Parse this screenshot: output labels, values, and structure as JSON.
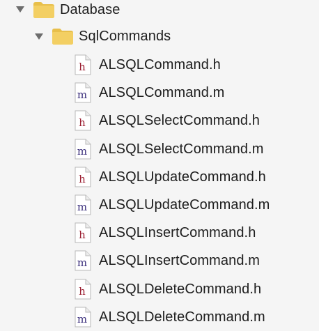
{
  "tree": {
    "database": {
      "label": "Database",
      "expanded_icon": "disclosure-triangle-down",
      "icon": "folder-icon"
    },
    "sqlcommands": {
      "label": "SqlCommands",
      "expanded_icon": "disclosure-triangle-down",
      "icon": "folder-icon"
    },
    "files": [
      {
        "name": "ALSQLCommand.h",
        "type_letter": "h"
      },
      {
        "name": "ALSQLCommand.m",
        "type_letter": "m"
      },
      {
        "name": "ALSQLSelectCommand.h",
        "type_letter": "h"
      },
      {
        "name": "ALSQLSelectCommand.m",
        "type_letter": "m"
      },
      {
        "name": "ALSQLUpdateCommand.h",
        "type_letter": "h"
      },
      {
        "name": "ALSQLUpdateCommand.m",
        "type_letter": "m"
      },
      {
        "name": "ALSQLInsertCommand.h",
        "type_letter": "h"
      },
      {
        "name": "ALSQLInsertCommand.m",
        "type_letter": "m"
      },
      {
        "name": "ALSQLDeleteCommand.h",
        "type_letter": "h"
      },
      {
        "name": "ALSQLDeleteCommand.m",
        "type_letter": "m"
      }
    ]
  },
  "colors": {
    "background": "#f5f5f5",
    "folder_body": "#f3cf63",
    "folder_tab": "#e8bf4a",
    "header_letter_h": "#9b1d30",
    "impl_letter_m": "#3b2f7c",
    "file_fill": "#ffffff",
    "file_stroke": "#b8b8b8",
    "disclosure": "#6d6d6d"
  }
}
